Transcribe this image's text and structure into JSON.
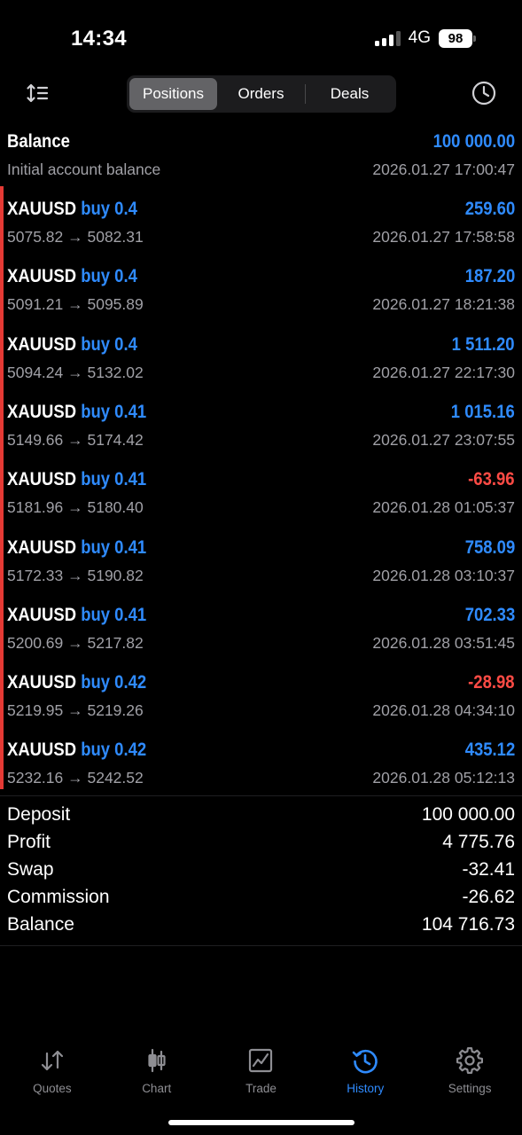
{
  "status_bar": {
    "time": "14:34",
    "network": "4G",
    "battery": "98"
  },
  "segments": [
    {
      "label": "Positions",
      "active": true
    },
    {
      "label": "Orders",
      "active": false
    },
    {
      "label": "Deals",
      "active": false
    }
  ],
  "balance_row": {
    "title": "Balance",
    "subtitle": "Initial account balance",
    "amount": "100 000.00",
    "time": "2026.01.27 17:00:47"
  },
  "deals": [
    {
      "symbol": "XAUUSD",
      "side": "buy 0.4",
      "prices": "5075.82 → 5082.31",
      "profit": "259.60",
      "time": "2026.01.27 17:58:58",
      "positive": true
    },
    {
      "symbol": "XAUUSD",
      "side": "buy 0.4",
      "prices": "5091.21 → 5095.89",
      "profit": "187.20",
      "time": "2026.01.27 18:21:38",
      "positive": true
    },
    {
      "symbol": "XAUUSD",
      "side": "buy 0.4",
      "prices": "5094.24 → 5132.02",
      "profit": "1 511.20",
      "time": "2026.01.27 22:17:30",
      "positive": true
    },
    {
      "symbol": "XAUUSD",
      "side": "buy 0.41",
      "prices": "5149.66 → 5174.42",
      "profit": "1 015.16",
      "time": "2026.01.27 23:07:55",
      "positive": true
    },
    {
      "symbol": "XAUUSD",
      "side": "buy 0.41",
      "prices": "5181.96 → 5180.40",
      "profit": "-63.96",
      "time": "2026.01.28 01:05:37",
      "positive": false
    },
    {
      "symbol": "XAUUSD",
      "side": "buy 0.41",
      "prices": "5172.33 → 5190.82",
      "profit": "758.09",
      "time": "2026.01.28 03:10:37",
      "positive": true
    },
    {
      "symbol": "XAUUSD",
      "side": "buy 0.41",
      "prices": "5200.69 → 5217.82",
      "profit": "702.33",
      "time": "2026.01.28 03:51:45",
      "positive": true
    },
    {
      "symbol": "XAUUSD",
      "side": "buy 0.42",
      "prices": "5219.95 → 5219.26",
      "profit": "-28.98",
      "time": "2026.01.28 04:34:10",
      "positive": false
    },
    {
      "symbol": "XAUUSD",
      "side": "buy 0.42",
      "prices": "5232.16 → 5242.52",
      "profit": "435.12",
      "time": "2026.01.28 05:12:13",
      "positive": true
    }
  ],
  "summary": [
    {
      "label": "Deposit",
      "value": "100 000.00"
    },
    {
      "label": "Profit",
      "value": "4 775.76"
    },
    {
      "label": "Swap",
      "value": "-32.41"
    },
    {
      "label": "Commission",
      "value": "-26.62"
    },
    {
      "label": "Balance",
      "value": "104 716.73"
    }
  ],
  "tabs": [
    {
      "label": "Quotes",
      "icon": "quotes-arrows-icon",
      "active": false
    },
    {
      "label": "Chart",
      "icon": "candlestick-icon",
      "active": false
    },
    {
      "label": "Trade",
      "icon": "trade-chart-icon",
      "active": false
    },
    {
      "label": "History",
      "icon": "history-clock-icon",
      "active": true
    },
    {
      "label": "Settings",
      "icon": "gear-icon",
      "active": false
    }
  ],
  "colors": {
    "positive": "#2f8bff",
    "negative": "#ff4b45",
    "side_accent": "#e53a35",
    "background": "#000000"
  }
}
